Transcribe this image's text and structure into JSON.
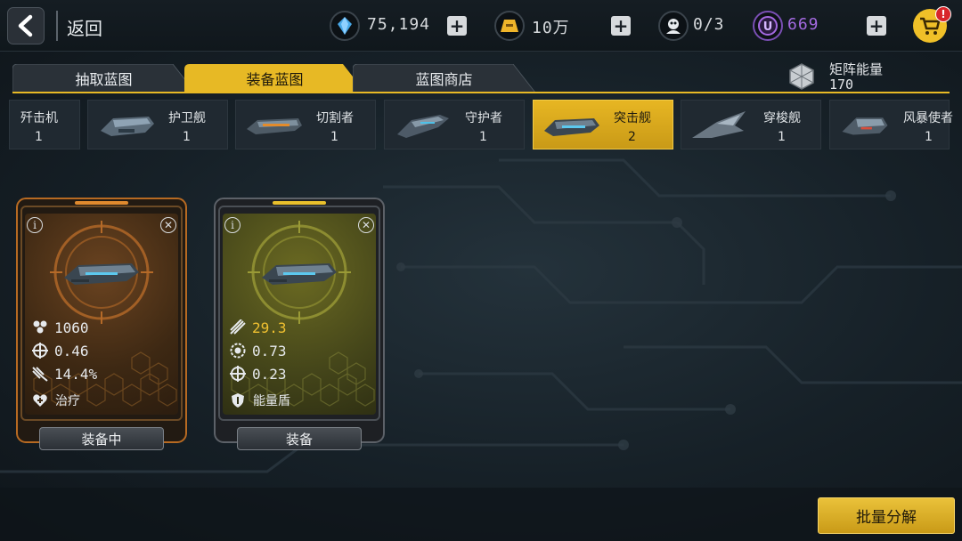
{
  "header": {
    "back_label": "返回",
    "resources": [
      {
        "icon": "crystal-icon",
        "value": "75,194"
      },
      {
        "icon": "gold-bar-icon",
        "value": "10万"
      },
      {
        "icon": "pilot-icon",
        "value": "0/3"
      },
      {
        "icon": "u-coin-icon",
        "value": "669"
      }
    ],
    "cart_badge": "!",
    "colors": {
      "accent": "#e7b925",
      "u_coin": "#a46ae0"
    }
  },
  "tabs": [
    {
      "label": "抽取蓝图",
      "active": false
    },
    {
      "label": "装备蓝图",
      "active": true
    },
    {
      "label": "蓝图商店",
      "active": false
    }
  ],
  "matrix_energy": {
    "label": "矩阵能量",
    "value": "170"
  },
  "ship_types": [
    {
      "name": "歼击机",
      "count": "1",
      "active": false
    },
    {
      "name": "护卫舰",
      "count": "1",
      "active": false
    },
    {
      "name": "切割者",
      "count": "1",
      "active": false
    },
    {
      "name": "守护者",
      "count": "1",
      "active": false
    },
    {
      "name": "突击舰",
      "count": "2",
      "active": true
    },
    {
      "name": "穿梭舰",
      "count": "1",
      "active": false
    },
    {
      "name": "风暴使者",
      "count": "1",
      "active": false
    }
  ],
  "cards": [
    {
      "theme": "orange",
      "stats": [
        {
          "icon": "hull-icon",
          "value": "1060"
        },
        {
          "icon": "crosshair-icon",
          "value": "0.46"
        },
        {
          "icon": "spread-icon",
          "value": "14.4%"
        }
      ],
      "skill": {
        "icon": "heal-icon",
        "label": "治疗"
      },
      "button": "装备中"
    },
    {
      "theme": "olive",
      "stats": [
        {
          "icon": "missile-icon",
          "value": "29.3"
        },
        {
          "icon": "gear-ring-icon",
          "value": "0.73"
        },
        {
          "icon": "crosshair-icon",
          "value": "0.23"
        }
      ],
      "skill": {
        "icon": "shield-icon",
        "label": "能量盾"
      },
      "button": "装备"
    }
  ],
  "bulk_button": "批量分解"
}
